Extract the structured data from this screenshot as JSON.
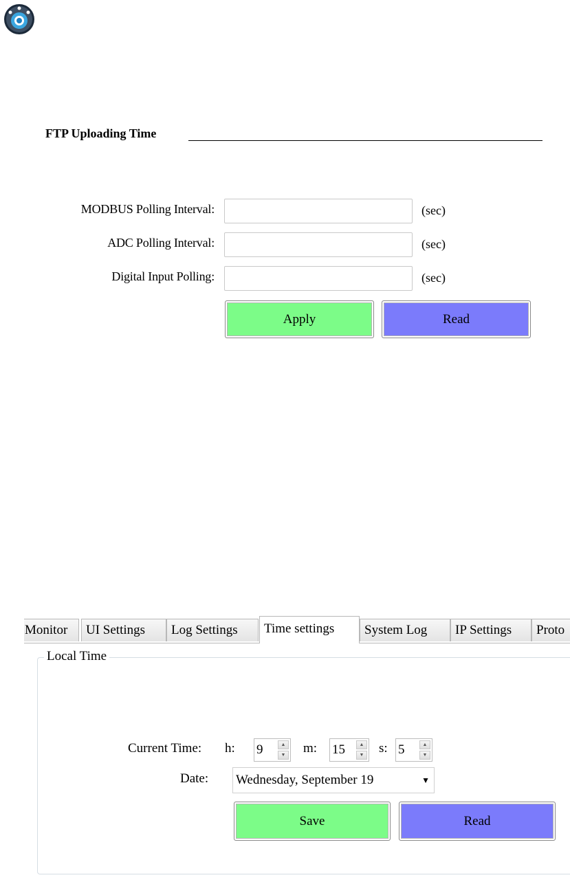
{
  "ftp_section": {
    "title": "FTP Uploading Time",
    "fields": [
      {
        "label": "MODBUS Polling Interval:",
        "value": "",
        "unit": "(sec)"
      },
      {
        "label": "ADC Polling Interval:",
        "value": "",
        "unit": "(sec)"
      },
      {
        "label": "Digital Input Polling:",
        "value": "",
        "unit": "(sec)"
      }
    ],
    "apply_label": "Apply",
    "read_label": "Read"
  },
  "tabs": [
    "Monitor",
    "UI Settings",
    "Log Settings",
    "Time settings",
    "System Log",
    "IP Settings",
    "Proto"
  ],
  "active_tab": "Time settings",
  "local_time": {
    "legend": "Local Time",
    "current_time_label": "Current Time:",
    "h_label": "h:",
    "h_value": "9",
    "m_label": "m:",
    "m_value": "15",
    "s_label": "s:",
    "s_value": "5",
    "date_label": "Date:",
    "date_value": "Wednesday, September 19",
    "save_label": "Save",
    "read_label": "Read"
  },
  "colors": {
    "apply_green": "#7cfc88",
    "read_blue": "#7b7bfb"
  },
  "icons": {
    "logo": "round-logo-icon",
    "date_caret": "chevron-down-icon",
    "spin_up": "spin-up-arrow-icon",
    "spin_down": "spin-down-arrow-icon"
  }
}
